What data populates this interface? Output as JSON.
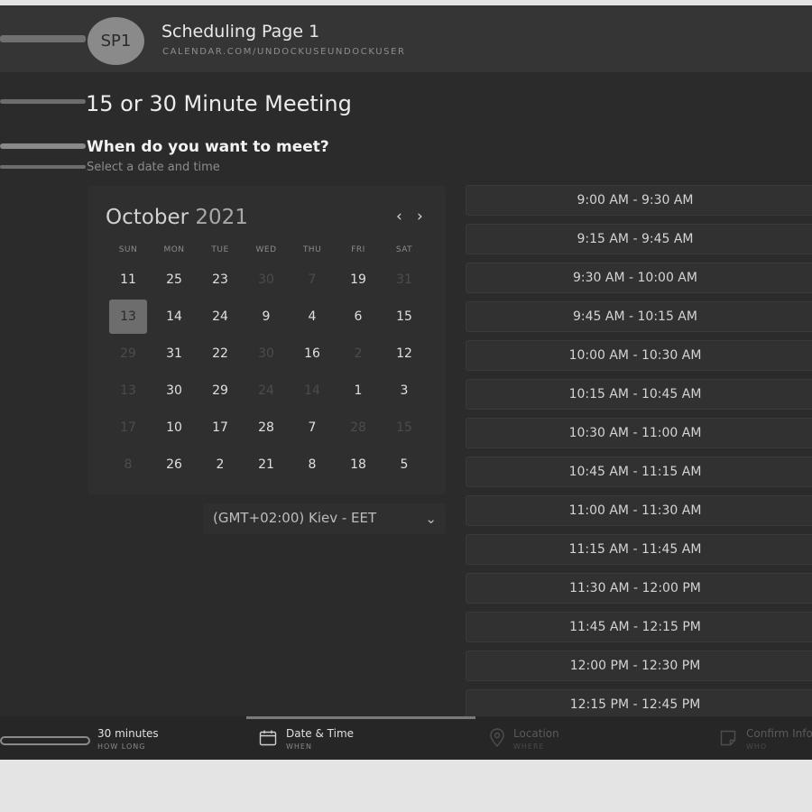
{
  "header": {
    "avatar_initials": "SP1",
    "title": "Scheduling Page 1",
    "url": "CALENDAR.COM/UNDOCKUSEUNDOCKUSER"
  },
  "meeting": {
    "title": "15 or 30 Minute Meeting",
    "question": "When do you want to meet?",
    "subtitle": "Select a date and time"
  },
  "calendar": {
    "month": "October",
    "year": "2021",
    "prev_icon": "‹",
    "next_icon": "›",
    "weekdays": [
      "SUN",
      "MON",
      "TUE",
      "WED",
      "THU",
      "FRI",
      "SAT"
    ],
    "weeks": [
      [
        {
          "d": "11",
          "dim": false
        },
        {
          "d": "25",
          "dim": false
        },
        {
          "d": "23",
          "dim": false
        },
        {
          "d": "30",
          "dim": true
        },
        {
          "d": "7",
          "dim": true
        },
        {
          "d": "19",
          "dim": false
        },
        {
          "d": "31",
          "dim": true
        }
      ],
      [
        {
          "d": "13",
          "dim": false,
          "selected": true
        },
        {
          "d": "14",
          "dim": false
        },
        {
          "d": "24",
          "dim": false
        },
        {
          "d": "9",
          "dim": false
        },
        {
          "d": "4",
          "dim": false
        },
        {
          "d": "6",
          "dim": false
        },
        {
          "d": "15",
          "dim": false
        }
      ],
      [
        {
          "d": "29",
          "dim": true
        },
        {
          "d": "31",
          "dim": false
        },
        {
          "d": "22",
          "dim": false
        },
        {
          "d": "30",
          "dim": true
        },
        {
          "d": "16",
          "dim": false
        },
        {
          "d": "2",
          "dim": true
        },
        {
          "d": "12",
          "dim": false
        }
      ],
      [
        {
          "d": "13",
          "dim": true
        },
        {
          "d": "30",
          "dim": false
        },
        {
          "d": "29",
          "dim": false
        },
        {
          "d": "24",
          "dim": true
        },
        {
          "d": "14",
          "dim": true
        },
        {
          "d": "1",
          "dim": false
        },
        {
          "d": "3",
          "dim": false
        }
      ],
      [
        {
          "d": "17",
          "dim": true
        },
        {
          "d": "10",
          "dim": false
        },
        {
          "d": "17",
          "dim": false
        },
        {
          "d": "28",
          "dim": false
        },
        {
          "d": "7",
          "dim": false
        },
        {
          "d": "28",
          "dim": true
        },
        {
          "d": "15",
          "dim": true
        }
      ],
      [
        {
          "d": "8",
          "dim": true
        },
        {
          "d": "26",
          "dim": false
        },
        {
          "d": "2",
          "dim": false
        },
        {
          "d": "21",
          "dim": false
        },
        {
          "d": "8",
          "dim": false
        },
        {
          "d": "18",
          "dim": false
        },
        {
          "d": "5",
          "dim": false
        }
      ]
    ]
  },
  "timezone": {
    "value": "(GMT+02:00) Kiev - EET",
    "chevron": "⌄"
  },
  "slots": [
    "9:00 AM - 9:30 AM",
    "9:15 AM - 9:45 AM",
    "9:30 AM - 10:00 AM",
    "9:45 AM - 10:15 AM",
    "10:00 AM - 10:30 AM",
    "10:15 AM - 10:45 AM",
    "10:30 AM - 11:00 AM",
    "10:45 AM - 11:15 AM",
    "11:00 AM - 11:30 AM",
    "11:15 AM - 11:45 AM",
    "11:30 AM - 12:00 PM",
    "11:45 AM - 12:15 PM",
    "12:00 PM - 12:30 PM",
    "12:15 PM - 12:45 PM"
  ],
  "steps": {
    "duration": {
      "label": "30 minutes",
      "sub": "HOW LONG"
    },
    "datetime": {
      "label": "Date & Time",
      "sub": "WHEN",
      "icon": "calendar-icon"
    },
    "location": {
      "label": "Location",
      "sub": "WHERE",
      "icon": "map-pin-icon"
    },
    "confirm": {
      "label": "Confirm Info",
      "sub": "WHO",
      "icon": "note-icon"
    }
  },
  "colors": {
    "background": "#2b2b2b",
    "header": "#353535",
    "selected_day": "#6d6d6d"
  }
}
